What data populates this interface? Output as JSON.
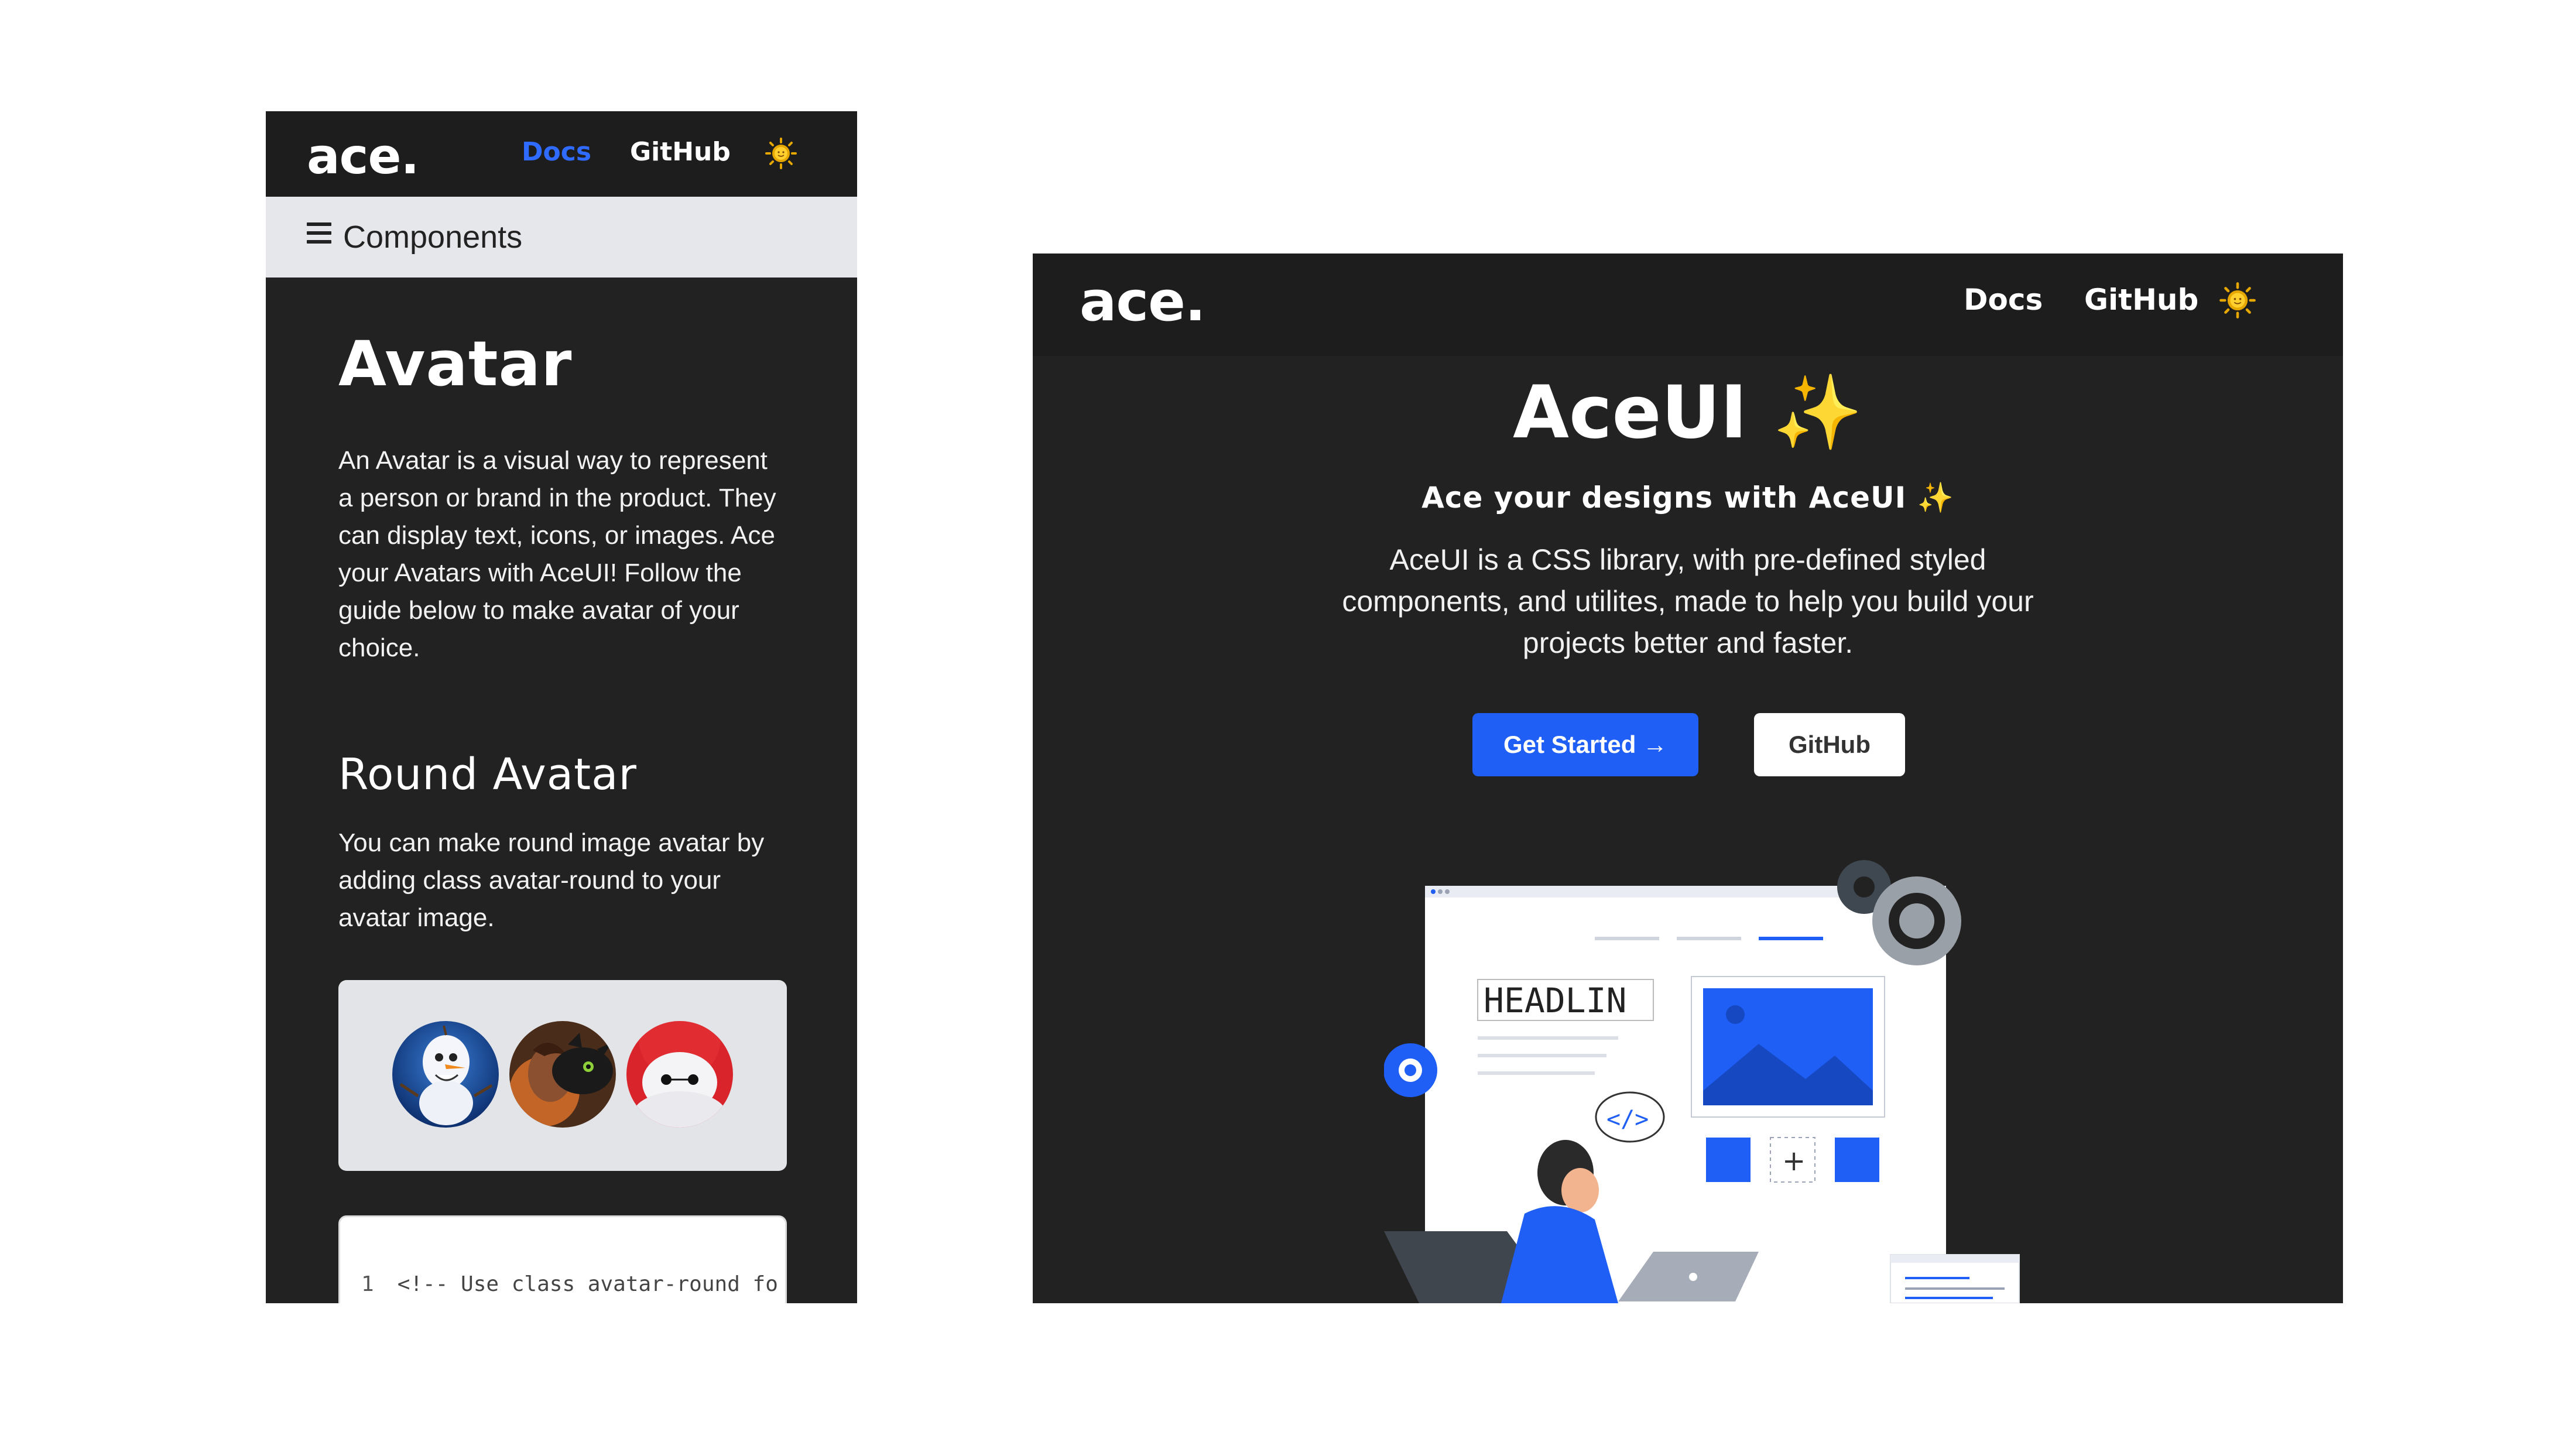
{
  "mobile": {
    "nav": {
      "logo": "ace.",
      "docs": "Docs",
      "github": "GitHub",
      "theme_icon": "sun-icon"
    },
    "components_bar": {
      "label": "Components",
      "icon": "hamburger-menu-icon"
    },
    "page_title": "Avatar",
    "intro": "An Avatar is a visual way to represent a person or brand in the product. They can display text, icons, or images. Ace your Avatars with AceUI! Follow the guide below to make avatar of your choice.",
    "section": {
      "title": "Round Avatar",
      "description": "You can make round image avatar by adding class avatar-round to your avatar image."
    },
    "code": {
      "line_number": "1",
      "line_text": "<!-- Use class avatar-round fo"
    }
  },
  "desktop": {
    "nav": {
      "logo": "ace.",
      "docs": "Docs",
      "github": "GitHub",
      "theme_icon": "sun-icon"
    },
    "title": "AceUI ✨",
    "subtitle": "Ace your designs with AceUI ✨",
    "description": "AceUI is a CSS library, with pre-defined styled components, and utilites, made to help you build your projects better and faster.",
    "primary_button": "Get Started →",
    "secondary_button": "GitHub",
    "illustration": {
      "headline_text": "HEADLIN",
      "code_icon": "</>"
    }
  },
  "colors": {
    "background_dark": "#222222",
    "nav_dark": "#1d1d1d",
    "accent_blue": "#1f5ff5",
    "link_blue": "#2f6bff",
    "components_bar": "#e6e7ea"
  }
}
